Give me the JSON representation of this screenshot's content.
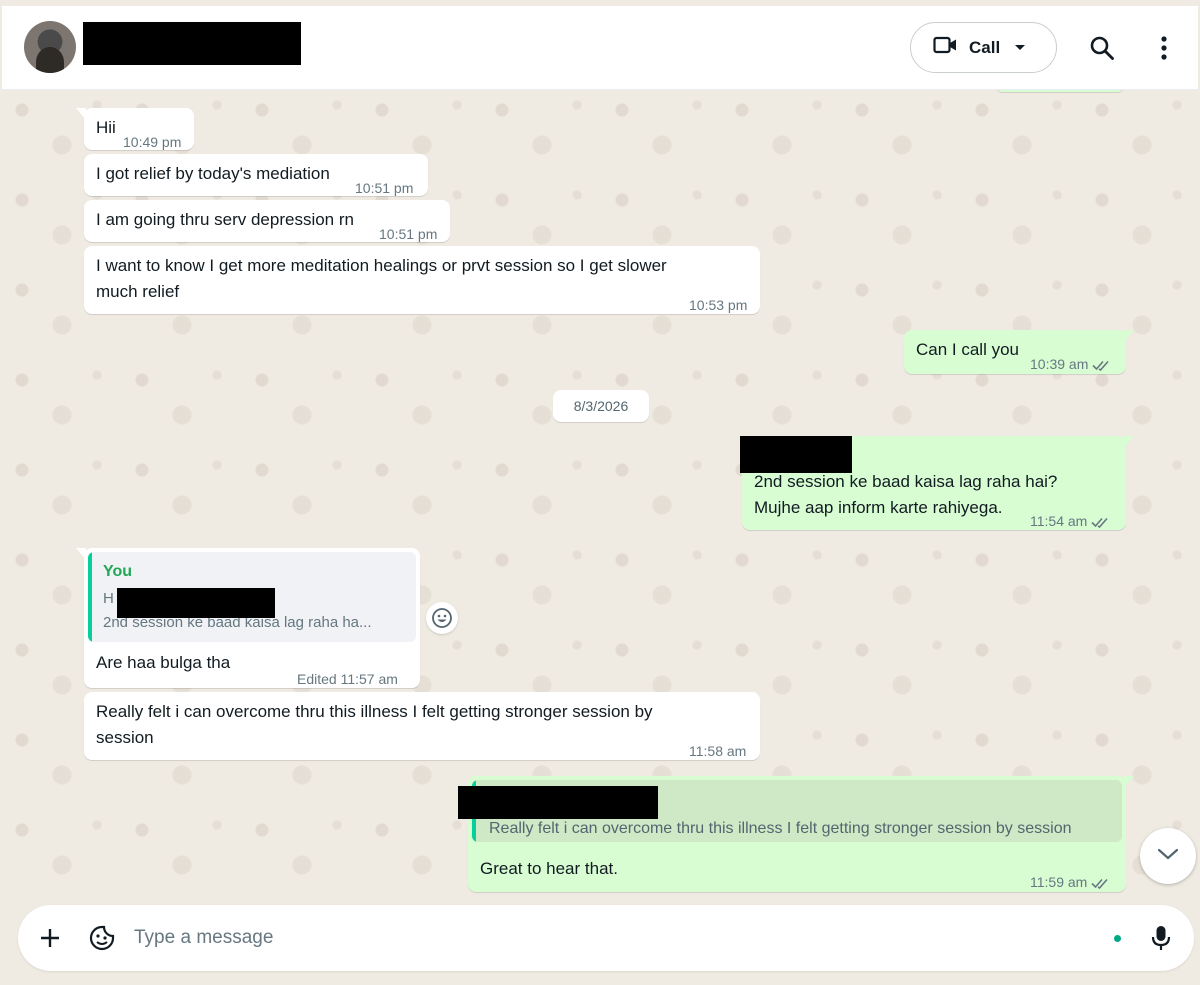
{
  "header": {
    "contact_name": "",
    "call_label": "Call"
  },
  "messages": {
    "m1": {
      "text": "Hii",
      "time": "10:49 pm"
    },
    "m2": {
      "text": "I got relief by today's mediation",
      "time": "10:51 pm"
    },
    "m3": {
      "text": "I am going thru serv depression rn",
      "time": "10:51 pm"
    },
    "m4": {
      "line1": "I want to know I get more meditation healings or prvt session so I get slower",
      "line2": "much relief",
      "time": "10:53 pm"
    },
    "m5": {
      "text": "Can I call you",
      "time": "10:39 am"
    },
    "date_divider": "8/3/2026",
    "m6": {
      "line1": "2nd session ke baad kaisa lag raha hai?",
      "line2": "Mujhe aap inform karte rahiyega.",
      "time": "11:54 am"
    },
    "m7": {
      "quote_author": "You",
      "quote_line1": "H",
      "quote_line2": "2nd session ke baad kaisa lag raha ha...",
      "text": "Are haa bulga tha",
      "time": "Edited 11:57 am"
    },
    "m8": {
      "line1": "Really felt i can overcome thru this illness I felt getting stronger session by",
      "line2": "session",
      "time": "11:58 am"
    },
    "m9": {
      "quote_text": "Really felt i can overcome thru this illness I felt getting stronger session by session",
      "text": "Great to hear that.",
      "time": "11:59 am"
    }
  },
  "composer": {
    "placeholder": "Type a message"
  },
  "colors": {
    "incoming_bubble": "#ffffff",
    "outgoing_bubble": "#d9fdd3",
    "accent": "#00a884",
    "chat_background": "#efeae2"
  },
  "icons": {
    "video": "video-camera-icon",
    "caret": "chevron-down-icon",
    "search": "search-icon",
    "menu": "kebab-menu-icon",
    "emoji": "emoji-icon",
    "scroll": "chevron-down-icon",
    "attach": "plus-icon",
    "sticker": "sticker-icon",
    "mic": "microphone-icon",
    "read": "double-check-icon"
  }
}
